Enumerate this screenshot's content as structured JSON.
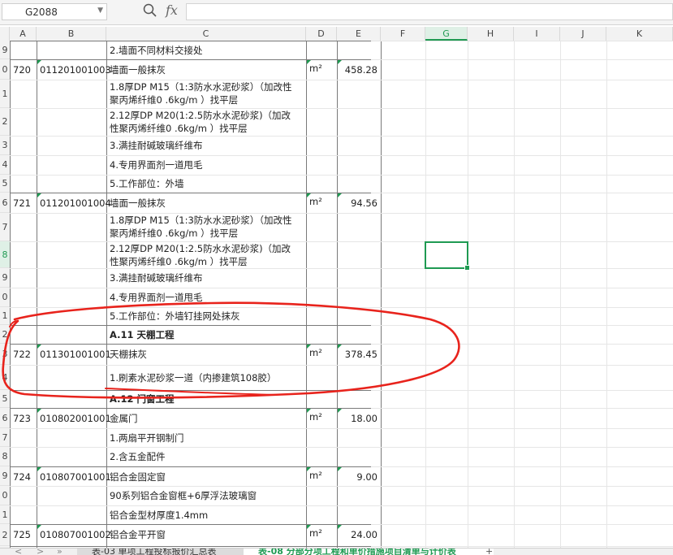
{
  "toolbar": {
    "cell_ref": "G2088",
    "fx": "fx",
    "formula": ""
  },
  "columns": [
    {
      "label": "A",
      "w": 33
    },
    {
      "label": "B",
      "w": 86
    },
    {
      "label": "C",
      "w": 246
    },
    {
      "label": "D",
      "w": 38
    },
    {
      "label": "E",
      "w": 54
    },
    {
      "label": "F",
      "w": 55
    },
    {
      "label": "G",
      "w": 52,
      "selected": true
    },
    {
      "label": "H",
      "w": 57
    },
    {
      "label": "I",
      "w": 57
    },
    {
      "label": "J",
      "w": 57
    },
    {
      "label": "K",
      "w": 82
    }
  ],
  "row_numbers": [
    "9",
    "0",
    "1",
    "2",
    "3",
    "4",
    "5",
    "6",
    "7",
    "8",
    "9",
    "0",
    "1",
    "2",
    "3",
    "4",
    "5",
    "6",
    "7",
    "8",
    "9",
    "0",
    "1",
    "2"
  ],
  "rows": [
    {
      "a": "",
      "b": "",
      "c": "2.墙面不同材料交接处",
      "d": "",
      "e": ""
    },
    {
      "a": "720",
      "b": "011201001003",
      "c": "墙面一般抹灰",
      "d": "m²",
      "e": "458.28"
    },
    {
      "a": "",
      "b": "",
      "c": [
        "1.8厚DP M15（1:3防水水泥砂浆）（加改性",
        "聚丙烯纤维0 .6kg/m ）找平层"
      ],
      "d": "",
      "e": ""
    },
    {
      "a": "",
      "b": "",
      "c": [
        "2.12厚DP M20(1:2.5防水水泥砂浆)（加改",
        "性聚丙烯纤维0 .6kg/m ）找平层"
      ],
      "d": "",
      "e": ""
    },
    {
      "a": "",
      "b": "",
      "c": "3.满挂耐碱玻璃纤维布",
      "d": "",
      "e": ""
    },
    {
      "a": "",
      "b": "",
      "c": "4.专用界面剂一道甩毛",
      "d": "",
      "e": ""
    },
    {
      "a": "",
      "b": "",
      "c": "5.工作部位：外墙",
      "d": "",
      "e": ""
    },
    {
      "a": "721",
      "b": "011201001004",
      "c": "墙面一般抹灰",
      "d": "m²",
      "e": "94.56"
    },
    {
      "a": "",
      "b": "",
      "c": [
        "1.8厚DP M15（1:3防水水泥砂浆）（加改性",
        "聚丙烯纤维0 .6kg/m ）找平层"
      ],
      "d": "",
      "e": ""
    },
    {
      "a": "",
      "b": "",
      "c": [
        "2.12厚DP M20(1:2.5防水水泥砂浆)（加改",
        "性聚丙烯纤维0 .6kg/m ）找平层"
      ],
      "d": "",
      "e": ""
    },
    {
      "a": "",
      "b": "",
      "c": "3.满挂耐碱玻璃纤维布",
      "d": "",
      "e": ""
    },
    {
      "a": "",
      "b": "",
      "c": "4.专用界面剂一道甩毛",
      "d": "",
      "e": ""
    },
    {
      "a": "",
      "b": "",
      "c": "5.工作部位：外墙钉挂网处抹灰",
      "d": "",
      "e": ""
    },
    {
      "a": "",
      "b": "",
      "c": "A.11  天棚工程",
      "bold": true,
      "d": "",
      "e": ""
    },
    {
      "a": "722",
      "b": "011301001001",
      "c": "天棚抹灰",
      "d": "m²",
      "e": "378.45"
    },
    {
      "a": "",
      "b": "",
      "c": "1.刷素水泥砂浆一道（内掺建筑108胶）",
      "d": "",
      "e": ""
    },
    {
      "a": "",
      "b": "",
      "c": "A.12  门窗工程",
      "bold": true,
      "d": "",
      "e": ""
    },
    {
      "a": "723",
      "b": "010802001001",
      "c": "金属门",
      "d": "m²",
      "e": "18.00"
    },
    {
      "a": "",
      "b": "",
      "c": "1.两扇平开钢制门",
      "d": "",
      "e": ""
    },
    {
      "a": "",
      "b": "",
      "c": "2.含五金配件",
      "d": "",
      "e": ""
    },
    {
      "a": "724",
      "b": "010807001001",
      "c": "铝合金固定窗",
      "d": "m²",
      "e": "9.00"
    },
    {
      "a": "",
      "b": "",
      "c": "90系列铝合金窗框+6厚浮法玻璃窗",
      "d": "",
      "e": ""
    },
    {
      "a": "",
      "b": "",
      "c": "铝合金型材厚度1.4mm",
      "d": "",
      "e": ""
    },
    {
      "a": "725",
      "b": "010807001002",
      "c": "铝合金平开窗",
      "d": "m²",
      "e": "24.00"
    }
  ],
  "tabs": [
    {
      "label": "表-03 单项工程投标报价汇总表",
      "active": false
    },
    {
      "label": "表-08 分部分项工程和单价措施项目清单与计价表",
      "active": true
    }
  ],
  "tab_nav": [
    "<",
    ">",
    "»"
  ],
  "add_tab": "+",
  "colors": {
    "accent": "#1f9a52",
    "annotation": "#e8231c"
  }
}
